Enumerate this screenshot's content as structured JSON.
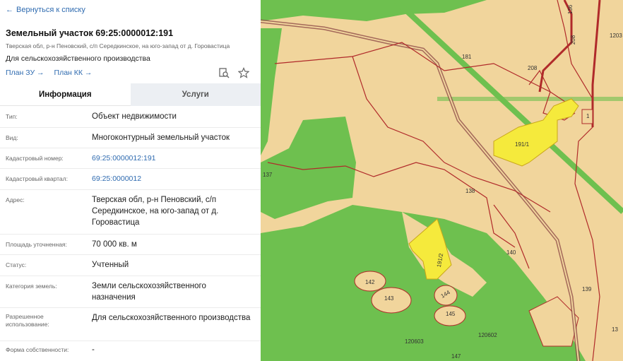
{
  "header": {
    "back_label": "Вернуться к списку",
    "title": "Земельный участок 69:25:0000012:191",
    "address_line": "Тверская обл, р-н Пеновский, с/п Середкинское, на юго-запад от д. Горовастица",
    "purpose": "Для сельскохозяйственного производства",
    "links": {
      "plan_zu": "План ЗУ",
      "plan_kk": "План КК"
    }
  },
  "tabs": {
    "info": "Информация",
    "services": "Услуги"
  },
  "fields": [
    {
      "label": "Тип:",
      "value": "Объект недвижимости"
    },
    {
      "label": "Вид:",
      "value": "Многоконтурный земельный участок"
    },
    {
      "label": "Кадастровый номер:",
      "value": "69:25:0000012:191"
    },
    {
      "label": "Кадастровый квартал:",
      "value": "69:25:0000012"
    },
    {
      "label": "Адрес:",
      "value": "Тверская обл, р-н Пеновский, с/п Середкинское, на юго-запад от д. Горовастица"
    },
    {
      "label": "Площадь уточненная:",
      "value": "70 000 кв. м"
    },
    {
      "label": "Статус:",
      "value": "Учтенный"
    },
    {
      "label": "Категория земель:",
      "value": "Земли сельскохозяйственного назначения"
    },
    {
      "label": "Разрешенное использование:",
      "value": "Для сельскохозяйственного производства"
    },
    {
      "label": "Форма собственности:",
      "value": "-"
    }
  ],
  "map": {
    "parcel_labels": [
      "136",
      "208",
      "1203",
      "181",
      "208",
      "1",
      "191/1",
      "137",
      "138",
      "191/2",
      "140",
      "142",
      "143",
      "144",
      "145",
      "139",
      "147",
      "120603",
      "120602",
      "13"
    ],
    "colors": {
      "field": "#f1d59c",
      "forest": "#6ec04f",
      "highlight": "#f5ea3c",
      "boundary": "#b02a2a"
    }
  },
  "colors": {
    "accent": "#2f6bb0"
  }
}
